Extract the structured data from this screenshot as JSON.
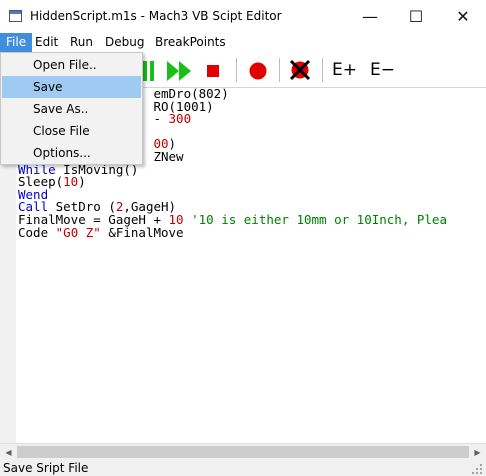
{
  "window": {
    "title": "HiddenScript.m1s  -  Mach3 VB Scipt Editor",
    "buttons": {
      "minimize": "—",
      "maximize": "☐",
      "close": "✕"
    }
  },
  "menubar": {
    "items": [
      {
        "label": "File",
        "active": true
      },
      {
        "label": "Edit"
      },
      {
        "label": "Run"
      },
      {
        "label": "Debug"
      },
      {
        "label": "BreakPoints"
      }
    ]
  },
  "file_menu": {
    "items": [
      {
        "label": "Open File.."
      },
      {
        "label": "Save",
        "highlighted": true
      },
      {
        "label": "Save As.."
      },
      {
        "label": "Close File"
      },
      {
        "label": "Options..."
      }
    ]
  },
  "toolbar": {
    "icons": [
      "pause-icon",
      "run-icon",
      "step-icon",
      "stop-icon",
      "breakpoint-icon",
      "clear-breakpoints-icon",
      "expand-icon",
      "collapse-icon"
    ],
    "expand_label": "E+",
    "collapse_label": "E−"
  },
  "editor": {
    "lines": {
      "l1a": "emDro(802)",
      "l2a": "RO(1001)",
      "l3a": "- ",
      "l3b": "300",
      "l5a": "00",
      "l5b": ")",
      "l6a": "ZNew",
      "l7kw": "While",
      "l7rest": " IsMoving()",
      "l8a": "Sleep(",
      "l8b": "10",
      "l8c": ")",
      "l9kw": "Wend",
      "l10kw": "Call",
      "l10rest": " SetDro (",
      "l10num": "2",
      "l10end": ",GageH)",
      "l11a": "FinalMove = GageH + ",
      "l11num": "10",
      "l11cmt": " '10 is either 10mm or 10Inch, Plea",
      "l12a": "Code ",
      "l12str": "\"G0 Z\"",
      "l12b": " &FinalMove"
    }
  },
  "statusbar": {
    "text": "Save Sript File"
  },
  "colors": {
    "menu_active": "#3f8fde",
    "menu_highlight": "#9fcbf2",
    "keyword": "#0000d0",
    "number": "#c00000",
    "comment": "#008000"
  }
}
